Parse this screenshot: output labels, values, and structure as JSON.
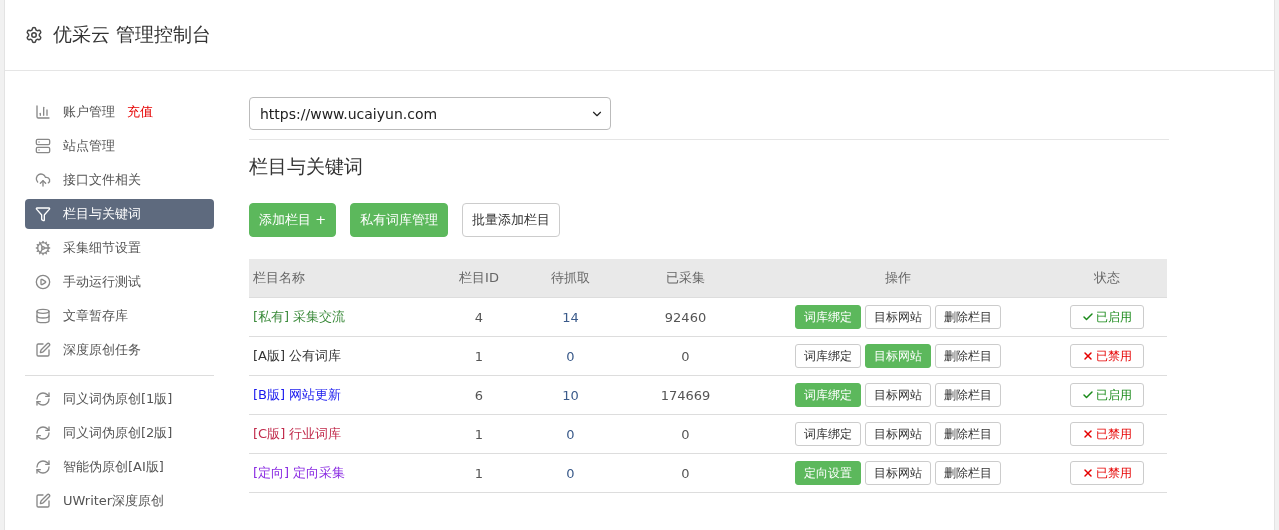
{
  "header": {
    "title": "优采云 管理控制台"
  },
  "sidebar": {
    "items": [
      {
        "label": "账户管理",
        "badge": "充值",
        "selected": false
      },
      {
        "label": "站点管理",
        "selected": false
      },
      {
        "label": "接口文件相关",
        "selected": false
      },
      {
        "label": "栏目与关键词",
        "selected": true
      },
      {
        "label": "采集细节设置",
        "selected": false
      },
      {
        "label": "手动运行测试",
        "selected": false
      },
      {
        "label": "文章暂存库",
        "selected": false
      },
      {
        "label": "深度原创任务",
        "selected": false
      },
      {
        "kind": "divider"
      },
      {
        "label": "同义词伪原创[1版]",
        "selected": false
      },
      {
        "label": "同义词伪原创[2版]",
        "selected": false
      },
      {
        "label": "智能伪原创[AI版]",
        "selected": false
      },
      {
        "label": "UWriter深度原创",
        "selected": false
      }
    ]
  },
  "site_select": {
    "value": "https://www.ucaiyun.com"
  },
  "section_title": "栏目与关键词",
  "toolbar": [
    {
      "label": "添加栏目 +",
      "primary": true
    },
    {
      "label": "私有词库管理",
      "primary": true
    },
    {
      "label": "批量添加栏目",
      "primary": false
    }
  ],
  "table": {
    "columns": [
      "栏目名称",
      "栏目ID",
      "待抓取",
      "已采集",
      "操作",
      "状态"
    ],
    "rows": [
      {
        "tag": "[私有]",
        "name": "采集交流",
        "color": "#3c8b3c",
        "id": "4",
        "pending": "14",
        "collected": "92460",
        "actions": [
          {
            "label": "词库绑定",
            "primary": true
          },
          {
            "label": "目标网站",
            "primary": false
          },
          {
            "label": "删除栏目",
            "primary": false
          }
        ],
        "status": {
          "label": "已启用",
          "enabled": true
        }
      },
      {
        "tag": "[A版]",
        "name": "公有词库",
        "color": "#333333",
        "id": "1",
        "pending": "0",
        "collected": "0",
        "actions": [
          {
            "label": "词库绑定",
            "primary": false
          },
          {
            "label": "目标网站",
            "primary": true
          },
          {
            "label": "删除栏目",
            "primary": false
          }
        ],
        "status": {
          "label": "已禁用",
          "enabled": false
        }
      },
      {
        "tag": "[B版]",
        "name": "网站更新",
        "color": "#1a1aee",
        "id": "6",
        "pending": "10",
        "collected": "174669",
        "actions": [
          {
            "label": "词库绑定",
            "primary": true
          },
          {
            "label": "目标网站",
            "primary": false
          },
          {
            "label": "删除栏目",
            "primary": false
          }
        ],
        "status": {
          "label": "已启用",
          "enabled": true
        }
      },
      {
        "tag": "[C版]",
        "name": "行业词库",
        "color": "#c0294a",
        "id": "1",
        "pending": "0",
        "collected": "0",
        "actions": [
          {
            "label": "词库绑定",
            "primary": false
          },
          {
            "label": "目标网站",
            "primary": false
          },
          {
            "label": "删除栏目",
            "primary": false
          }
        ],
        "status": {
          "label": "已禁用",
          "enabled": false
        }
      },
      {
        "tag": "[定向]",
        "name": "定向采集",
        "color": "#8a2be2",
        "id": "1",
        "pending": "0",
        "collected": "0",
        "actions": [
          {
            "label": "定向设置",
            "primary": true
          },
          {
            "label": "目标网站",
            "primary": false
          },
          {
            "label": "删除栏目",
            "primary": false
          }
        ],
        "status": {
          "label": "已禁用",
          "enabled": false
        }
      }
    ]
  }
}
